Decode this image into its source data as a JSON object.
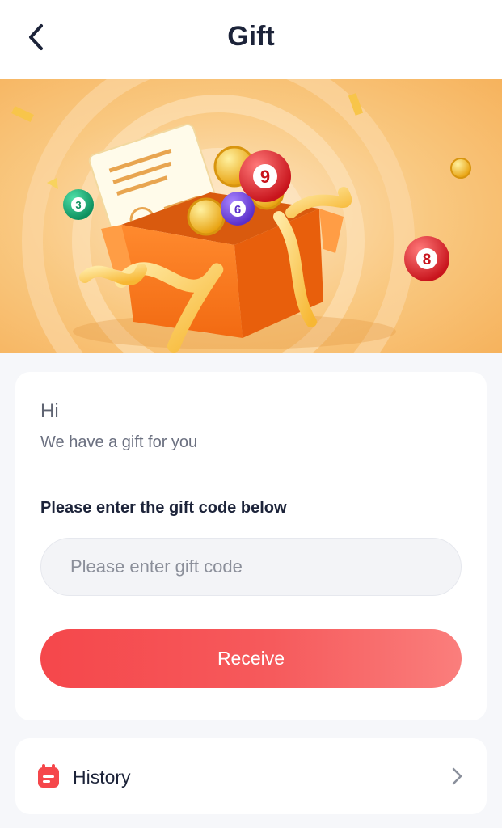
{
  "header": {
    "title": "Gift",
    "back_icon": "chevron-left-icon"
  },
  "banner": {
    "description_icons": [
      "gift-box",
      "lottery-ball",
      "coin"
    ],
    "balls": [
      "3",
      "9",
      "6",
      "8"
    ]
  },
  "card": {
    "greeting": "Hi",
    "subtitle": "We have a gift for you",
    "prompt": "Please enter the gift code below",
    "input": {
      "value": "",
      "placeholder": "Please enter gift code"
    },
    "button_label": "Receive"
  },
  "history": {
    "label": "History",
    "icon": "calendar-icon",
    "arrow": "chevron-right-icon"
  },
  "colors": {
    "accent": "#f5474b",
    "title": "#1c2339",
    "background": "#f6f7fa",
    "banner": "#f7b860"
  }
}
